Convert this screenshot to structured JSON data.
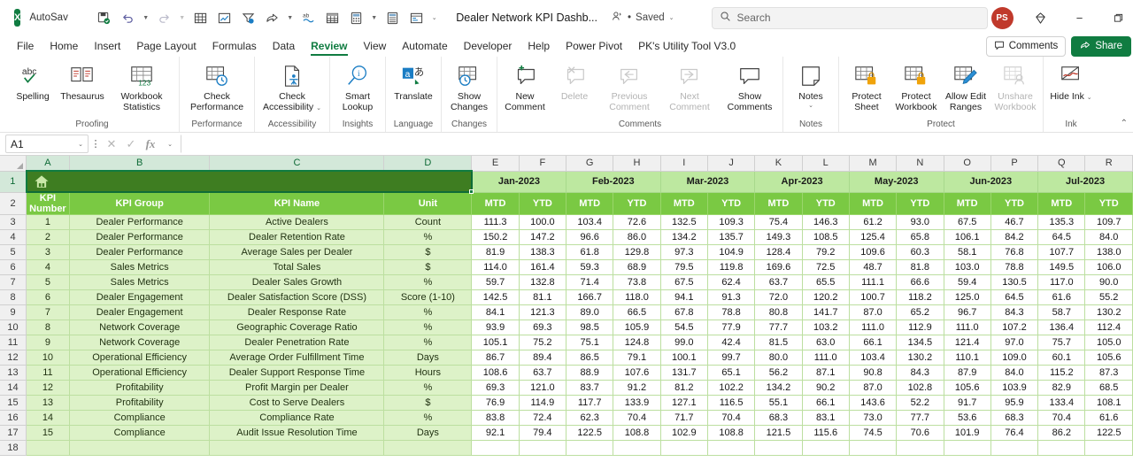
{
  "titlebar": {
    "app_icon": "excel-logo",
    "autosave_label": "AutoSave",
    "autosave_state": "On",
    "document_title": "Dealer Network KPI Dashb...",
    "saved_status": "Saved",
    "quick_access": [
      {
        "name": "save-icon",
        "glyph": "💾"
      },
      {
        "name": "undo-icon",
        "glyph": "↶"
      },
      {
        "name": "redo-icon",
        "glyph": "↷"
      },
      {
        "name": "table-icon",
        "glyph": "⊞"
      },
      {
        "name": "chart-icon",
        "glyph": "📈"
      },
      {
        "name": "filter-icon",
        "glyph": "▽"
      },
      {
        "name": "share-arrow-icon",
        "glyph": "➦"
      },
      {
        "name": "spelling-icon",
        "glyph": "ab"
      },
      {
        "name": "pivot-table-icon",
        "glyph": "▦"
      },
      {
        "name": "calculator-icon",
        "glyph": "▤"
      },
      {
        "name": "sheet-icon",
        "glyph": "▥"
      },
      {
        "name": "form-icon",
        "glyph": "☰"
      },
      {
        "name": "customize-qat-icon",
        "glyph": "⌄"
      }
    ],
    "search_placeholder": "Search",
    "search_value": "",
    "avatar_initials": "PS",
    "diamond_icon": "diamond-icon",
    "window_minimize": "−",
    "window_restore": "❐",
    "window_close": "✕"
  },
  "menubar": {
    "tabs": [
      "File",
      "Home",
      "Insert",
      "Page Layout",
      "Formulas",
      "Data",
      "Review",
      "View",
      "Automate",
      "Developer",
      "Help",
      "Power Pivot",
      "PK's Utility Tool V3.0"
    ],
    "active_tab": "Review",
    "comments_label": "Comments",
    "share_label": "Share"
  },
  "ribbon": {
    "groups": [
      {
        "label": "Proofing",
        "items": [
          {
            "label": "Spelling",
            "icon": "spelling-check-icon"
          },
          {
            "label": "Thesaurus",
            "icon": "thesaurus-book-icon"
          },
          {
            "label": "Workbook Statistics",
            "icon": "workbook-statistics-icon"
          }
        ]
      },
      {
        "label": "Performance",
        "items": [
          {
            "label": "Check Performance",
            "icon": "check-performance-icon"
          }
        ]
      },
      {
        "label": "Accessibility",
        "items": [
          {
            "label": "Check Accessibility",
            "icon": "check-accessibility-icon",
            "dropdown": true
          }
        ]
      },
      {
        "label": "Insights",
        "items": [
          {
            "label": "Smart Lookup",
            "icon": "smart-lookup-icon"
          }
        ]
      },
      {
        "label": "Language",
        "items": [
          {
            "label": "Translate",
            "icon": "translate-icon"
          }
        ]
      },
      {
        "label": "Changes",
        "items": [
          {
            "label": "Show Changes",
            "icon": "show-changes-icon"
          }
        ]
      },
      {
        "label": "Comments",
        "items": [
          {
            "label": "New Comment",
            "icon": "new-comment-icon"
          },
          {
            "label": "Delete",
            "icon": "delete-comment-icon",
            "disabled": true
          },
          {
            "label": "Previous Comment",
            "icon": "previous-comment-icon",
            "disabled": true
          },
          {
            "label": "Next Comment",
            "icon": "next-comment-icon",
            "disabled": true
          },
          {
            "label": "Show Comments",
            "icon": "show-comments-icon"
          }
        ]
      },
      {
        "label": "Notes",
        "items": [
          {
            "label": "Notes",
            "icon": "notes-icon",
            "dropdown": true
          }
        ]
      },
      {
        "label": "Protect",
        "items": [
          {
            "label": "Protect Sheet",
            "icon": "protect-sheet-icon"
          },
          {
            "label": "Protect Workbook",
            "icon": "protect-workbook-icon"
          },
          {
            "label": "Allow Edit Ranges",
            "icon": "allow-edit-ranges-icon"
          },
          {
            "label": "Unshare Workbook",
            "icon": "unshare-workbook-icon",
            "disabled": true
          }
        ]
      },
      {
        "label": "Ink",
        "items": [
          {
            "label": "Hide Ink",
            "icon": "hide-ink-icon",
            "dropdown": true
          }
        ]
      }
    ]
  },
  "formula_bar": {
    "name_box_value": "A1",
    "formula_value": "",
    "cancel_icon": "cancel-icon",
    "enter_icon": "enter-icon",
    "fx_label": "fx"
  },
  "sheet": {
    "column_headers": [
      "A",
      "B",
      "C",
      "D",
      "E",
      "F",
      "G",
      "H",
      "I",
      "J",
      "K",
      "L",
      "M",
      "N",
      "O",
      "P",
      "Q",
      "R"
    ],
    "row_numbers": [
      1,
      2,
      3,
      4,
      5,
      6,
      7,
      8,
      9,
      10,
      11,
      12,
      13,
      14,
      15,
      16,
      17,
      18
    ],
    "selected_range": "A1:D1",
    "banner_icon": "home-icon",
    "banner_text": "",
    "headers": [
      "KPI Number",
      "KPI Group",
      "KPI Name",
      "Unit"
    ],
    "months": [
      "Jan-2023",
      "Feb-2023",
      "Mar-2023",
      "Apr-2023",
      "May-2023",
      "Jun-2023",
      "Jul-2023"
    ],
    "sub_headers": [
      "MTD",
      "YTD"
    ],
    "rows": [
      {
        "num": "1",
        "group": "Dealer Performance",
        "name": "Active Dealers",
        "unit": "Count",
        "values": [
          "111.3",
          "100.0",
          "103.4",
          "72.6",
          "132.5",
          "109.3",
          "75.4",
          "146.3",
          "61.2",
          "93.0",
          "67.5",
          "46.7",
          "135.3",
          "109.7"
        ]
      },
      {
        "num": "2",
        "group": "Dealer Performance",
        "name": "Dealer Retention Rate",
        "unit": "%",
        "values": [
          "150.2",
          "147.2",
          "96.6",
          "86.0",
          "134.2",
          "135.7",
          "149.3",
          "108.5",
          "125.4",
          "65.8",
          "106.1",
          "84.2",
          "64.5",
          "84.0"
        ]
      },
      {
        "num": "3",
        "group": "Dealer Performance",
        "name": "Average Sales per Dealer",
        "unit": "$",
        "values": [
          "81.9",
          "138.3",
          "61.8",
          "129.8",
          "97.3",
          "104.9",
          "128.4",
          "79.2",
          "109.6",
          "60.3",
          "58.1",
          "76.8",
          "107.7",
          "138.0"
        ]
      },
      {
        "num": "4",
        "group": "Sales Metrics",
        "name": "Total Sales",
        "unit": "$",
        "values": [
          "114.0",
          "161.4",
          "59.3",
          "68.9",
          "79.5",
          "119.8",
          "169.6",
          "72.5",
          "48.7",
          "81.8",
          "103.0",
          "78.8",
          "149.5",
          "106.0"
        ]
      },
      {
        "num": "5",
        "group": "Sales Metrics",
        "name": "Dealer Sales Growth",
        "unit": "%",
        "values": [
          "59.7",
          "132.8",
          "71.4",
          "73.8",
          "67.5",
          "62.4",
          "63.7",
          "65.5",
          "111.1",
          "66.6",
          "59.4",
          "130.5",
          "117.0",
          "90.0"
        ]
      },
      {
        "num": "6",
        "group": "Dealer Engagement",
        "name": "Dealer Satisfaction Score (DSS)",
        "unit": "Score (1-10)",
        "values": [
          "142.5",
          "81.1",
          "166.7",
          "118.0",
          "94.1",
          "91.3",
          "72.0",
          "120.2",
          "100.7",
          "118.2",
          "125.0",
          "64.5",
          "61.6",
          "55.2"
        ]
      },
      {
        "num": "7",
        "group": "Dealer Engagement",
        "name": "Dealer Response Rate",
        "unit": "%",
        "values": [
          "84.1",
          "121.3",
          "89.0",
          "66.5",
          "67.8",
          "78.8",
          "80.8",
          "141.7",
          "87.0",
          "65.2",
          "96.7",
          "84.3",
          "58.7",
          "130.2"
        ]
      },
      {
        "num": "8",
        "group": "Network Coverage",
        "name": "Geographic Coverage Ratio",
        "unit": "%",
        "values": [
          "93.9",
          "69.3",
          "98.5",
          "105.9",
          "54.5",
          "77.9",
          "77.7",
          "103.2",
          "111.0",
          "112.9",
          "111.0",
          "107.2",
          "136.4",
          "112.4"
        ]
      },
      {
        "num": "9",
        "group": "Network Coverage",
        "name": "Dealer Penetration Rate",
        "unit": "%",
        "values": [
          "105.1",
          "75.2",
          "75.1",
          "124.8",
          "99.0",
          "42.4",
          "81.5",
          "63.0",
          "66.1",
          "134.5",
          "121.4",
          "97.0",
          "75.7",
          "105.0"
        ]
      },
      {
        "num": "10",
        "group": "Operational Efficiency",
        "name": "Average Order Fulfillment Time",
        "unit": "Days",
        "values": [
          "86.7",
          "89.4",
          "86.5",
          "79.1",
          "100.1",
          "99.7",
          "80.0",
          "111.0",
          "103.4",
          "130.2",
          "110.1",
          "109.0",
          "60.1",
          "105.6"
        ]
      },
      {
        "num": "11",
        "group": "Operational Efficiency",
        "name": "Dealer Support Response Time",
        "unit": "Hours",
        "values": [
          "108.6",
          "63.7",
          "88.9",
          "107.6",
          "131.7",
          "65.1",
          "56.2",
          "87.1",
          "90.8",
          "84.3",
          "87.9",
          "84.0",
          "115.2",
          "87.3"
        ]
      },
      {
        "num": "12",
        "group": "Profitability",
        "name": "Profit Margin per Dealer",
        "unit": "%",
        "values": [
          "69.3",
          "121.0",
          "83.7",
          "91.2",
          "81.2",
          "102.2",
          "134.2",
          "90.2",
          "87.0",
          "102.8",
          "105.6",
          "103.9",
          "82.9",
          "68.5"
        ]
      },
      {
        "num": "13",
        "group": "Profitability",
        "name": "Cost to Serve Dealers",
        "unit": "$",
        "values": [
          "76.9",
          "114.9",
          "117.7",
          "133.9",
          "127.1",
          "116.5",
          "55.1",
          "66.1",
          "143.6",
          "52.2",
          "91.7",
          "95.9",
          "133.4",
          "108.1"
        ]
      },
      {
        "num": "14",
        "group": "Compliance",
        "name": "Compliance Rate",
        "unit": "%",
        "values": [
          "83.8",
          "72.4",
          "62.3",
          "70.4",
          "71.7",
          "70.4",
          "68.3",
          "83.1",
          "73.0",
          "77.7",
          "53.6",
          "68.3",
          "70.4",
          "61.6"
        ]
      },
      {
        "num": "15",
        "group": "Compliance",
        "name": "Audit Issue Resolution Time",
        "unit": "Days",
        "values": [
          "92.1",
          "79.4",
          "122.5",
          "108.8",
          "102.9",
          "108.8",
          "121.5",
          "115.6",
          "74.5",
          "70.6",
          "101.9",
          "76.4",
          "86.2",
          "122.5"
        ]
      }
    ]
  },
  "colors": {
    "accent_green": "#107c41",
    "banner_green": "#3e7d21",
    "header_green": "#7ac943",
    "month_green": "#bde8a0",
    "data_green": "#ddf2c8"
  }
}
